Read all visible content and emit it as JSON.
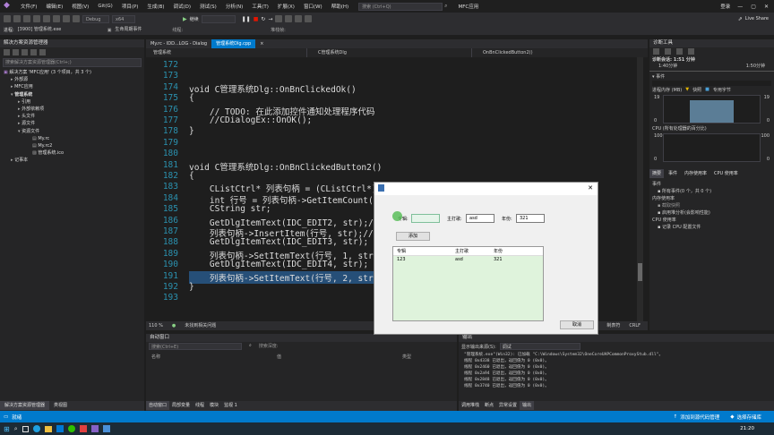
{
  "menu": {
    "items": [
      "文件(F)",
      "编辑(E)",
      "视图(V)",
      "Git(G)",
      "项目(P)",
      "生成(B)",
      "调试(D)",
      "测试(S)",
      "分析(N)",
      "工具(T)",
      "扩展(X)",
      "窗口(W)",
      "帮助(H)"
    ],
    "search": "搜索 (Ctrl+Q)",
    "app_name": "MFC应用",
    "login": "登录",
    "live_share": "Live Share"
  },
  "toolbar": {
    "config": "Debug",
    "platform": "x64",
    "continue": "继续",
    "process_label": "进程:",
    "process": "[3900] 管理系统.exe",
    "lifecycle": "生命周期事件",
    "thread_label": "线程:",
    "stack_label": "堆栈帧:"
  },
  "solution_explorer": {
    "title": "解决方案资源管理器",
    "search": "搜索解决方案资源管理器(Ctrl+;)",
    "items": [
      "解决方案 'MFC应用' (3 个项目，共 3 个)",
      "外部源",
      "MFC应用",
      "管理系统",
      "引用",
      "外部依赖项",
      "头文件",
      "源文件",
      "资源文件",
      "My.rc",
      "My.rc2",
      "管理系统.ico",
      "记事本"
    ]
  },
  "tabs": [
    "My.rc - IDD...LOG - Dialog",
    "管理系统Dlg.cpp",
    "×"
  ],
  "nav": {
    "project": "管理系统",
    "class": "C管理系统Dlg",
    "method": "OnBnClickedButton2()"
  },
  "code": {
    "lines": [
      "172",
      "173",
      "174",
      "175",
      "176",
      "177",
      "178",
      "179",
      "180",
      "181",
      "182",
      "183",
      "184",
      "185",
      "186",
      "187",
      "188",
      "189",
      "190",
      "191",
      "192",
      "193"
    ],
    "l174": "void C管理系统Dlg::OnBnClickedOk()",
    "l175": "{",
    "l176": "    // TODO: 在此添加控件通知处理程序代码",
    "l177": "    //CDialogEx::OnOK();",
    "l178": "}",
    "l181": "void C管理系统Dlg::OnBnClickedButton2()",
    "l182": "{",
    "l183": "    CListCtrl* 列表句柄 = (CListCtrl*)",
    "l184": "    int 行号 = 列表句柄->GetItemCount(",
    "l185": "    CString str;",
    "l186": "    GetDlgItemText(IDC_EDIT2, str);//获",
    "l187": "    列表句柄->InsertItem(行号, str);//",
    "l188": "    GetDlgItemText(IDC_EDIT3, str);",
    "l189": "    列表句柄->SetItemText(行号, 1, str",
    "l190": "    GetDlgItemText(IDC_EDIT4, str);",
    "l191": "    列表句柄->SetItemText(行号, 2, str",
    "l192": "}"
  },
  "editor_status": {
    "zoom": "110 %",
    "issues": "未找到相关问题",
    "line": "制表符",
    "crlf": "CRLF"
  },
  "dialog": {
    "label1": "专辑:",
    "label2": "主打歌:",
    "value2": "asd",
    "label3": "年份:",
    "value3": "321",
    "add": "添加",
    "cancel": "取消",
    "columns": [
      "专辑",
      "主打歌",
      "年份"
    ],
    "row": [
      "123",
      "asd",
      "321"
    ]
  },
  "diag": {
    "title": "诊断工具",
    "session": "诊断会话: 1:51 分钟",
    "t1": "1:40分钟",
    "t2": "1:50分钟",
    "events": "事件",
    "memory": "进程内存 (MB)",
    "snapshot": "快照",
    "private": "专用字节",
    "mem_top": "19",
    "mem_bot": "0",
    "cpu": "CPU (所有处理器的百分比)",
    "cpu_top": "100",
    "cpu_bot": "0",
    "tabs": [
      "摘要",
      "事件",
      "内存使用率",
      "CPU 使用率"
    ],
    "ev_h": "事件",
    "ev_all": "所有事件(0 个，共 0 个)",
    "mem_h": "内存使用率",
    "snap": "截取快照",
    "heap": "启用堆分析(会影响性能)",
    "cpu_h": "CPU 使用率",
    "cpu_rec": "记录 CPU 配置文件"
  },
  "auto": {
    "title": "自动窗口",
    "search": "搜索(Ctrl+E)",
    "search2": "搜索深度:",
    "col1": "名称",
    "col2": "值",
    "col3": "类型",
    "tabs": [
      "自动窗口",
      "局部变量",
      "线程",
      "模块",
      "监视 1"
    ]
  },
  "output": {
    "title": "输出",
    "source_label": "显示输出来源(S):",
    "source": "调试",
    "lines": [
      "\"管理系统.exe\"(Win32): 已加载 \"C:\\Windows\\System32\\OneCoreUAPCommonProxyStub.dll\"。",
      "线程 0x4338 已退出，返回值为 0 (0x0)。",
      "线程 0x2460 已退出，返回值为 0 (0x0)。",
      "线程 0x2a94 已退出，返回值为 0 (0x0)。",
      "线程 0x2848 已退出，返回值为 0 (0x0)。",
      "线程 0x3740 已退出，返回值为 0 (0x0)。"
    ],
    "tabs": [
      "调用堆栈",
      "断点",
      "异常设置",
      "输出"
    ]
  },
  "statusbar": {
    "ready": "就绪",
    "add_source": "添加到源代码管理",
    "select_repo": "选择存储库",
    "time": "21:20"
  },
  "left_bottom_tabs": [
    "解决方案资源管理器",
    "类视图"
  ]
}
